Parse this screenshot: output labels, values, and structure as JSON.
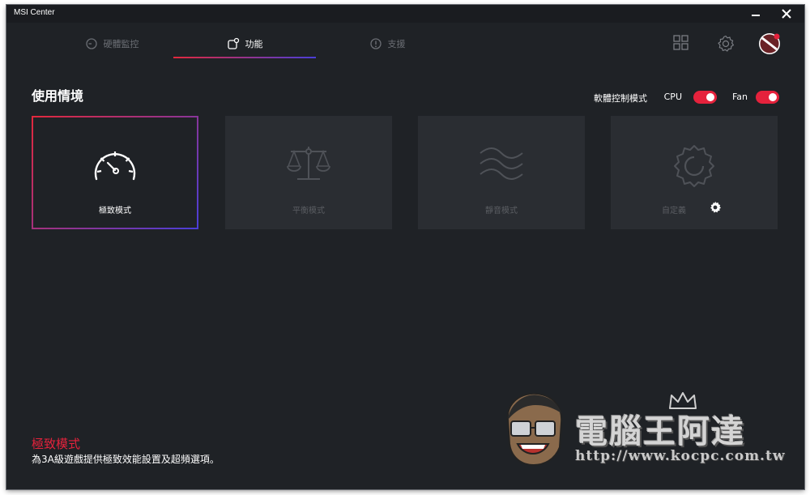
{
  "window": {
    "title": "MSI Center"
  },
  "tabs": [
    {
      "label": "硬體監控",
      "icon": "gauge-circle-icon"
    },
    {
      "label": "功能",
      "icon": "feature-icon"
    },
    {
      "label": "支援",
      "icon": "support-icon"
    }
  ],
  "active_tab": 1,
  "top_icons": [
    "grid-icon",
    "settings-icon",
    "avatar"
  ],
  "section": {
    "title": "使用情境"
  },
  "controls": {
    "mode_label": "軟體控制模式",
    "cpu_label": "CPU",
    "cpu_on": true,
    "fan_label": "Fan",
    "fan_on": true
  },
  "modes": [
    {
      "label": "極致模式",
      "icon": "speedometer-icon",
      "active": true
    },
    {
      "label": "平衡模式",
      "icon": "balance-scale-icon",
      "active": false
    },
    {
      "label": "靜音模式",
      "icon": "wave-icon",
      "active": false
    },
    {
      "label": "自定義",
      "icon": "gear-icon",
      "active": false
    }
  ],
  "description": {
    "title": "極致模式",
    "text": "為3A級遊戲提供極致效能設置及超頻選項。"
  },
  "watermark": {
    "text": "電腦王阿達",
    "url": "http://www.kocpc.com.tw"
  },
  "colors": {
    "accent_red": "#e5223c",
    "accent_blue": "#4a3ed8",
    "background": "#1f2226",
    "card": "#2a2d32"
  }
}
